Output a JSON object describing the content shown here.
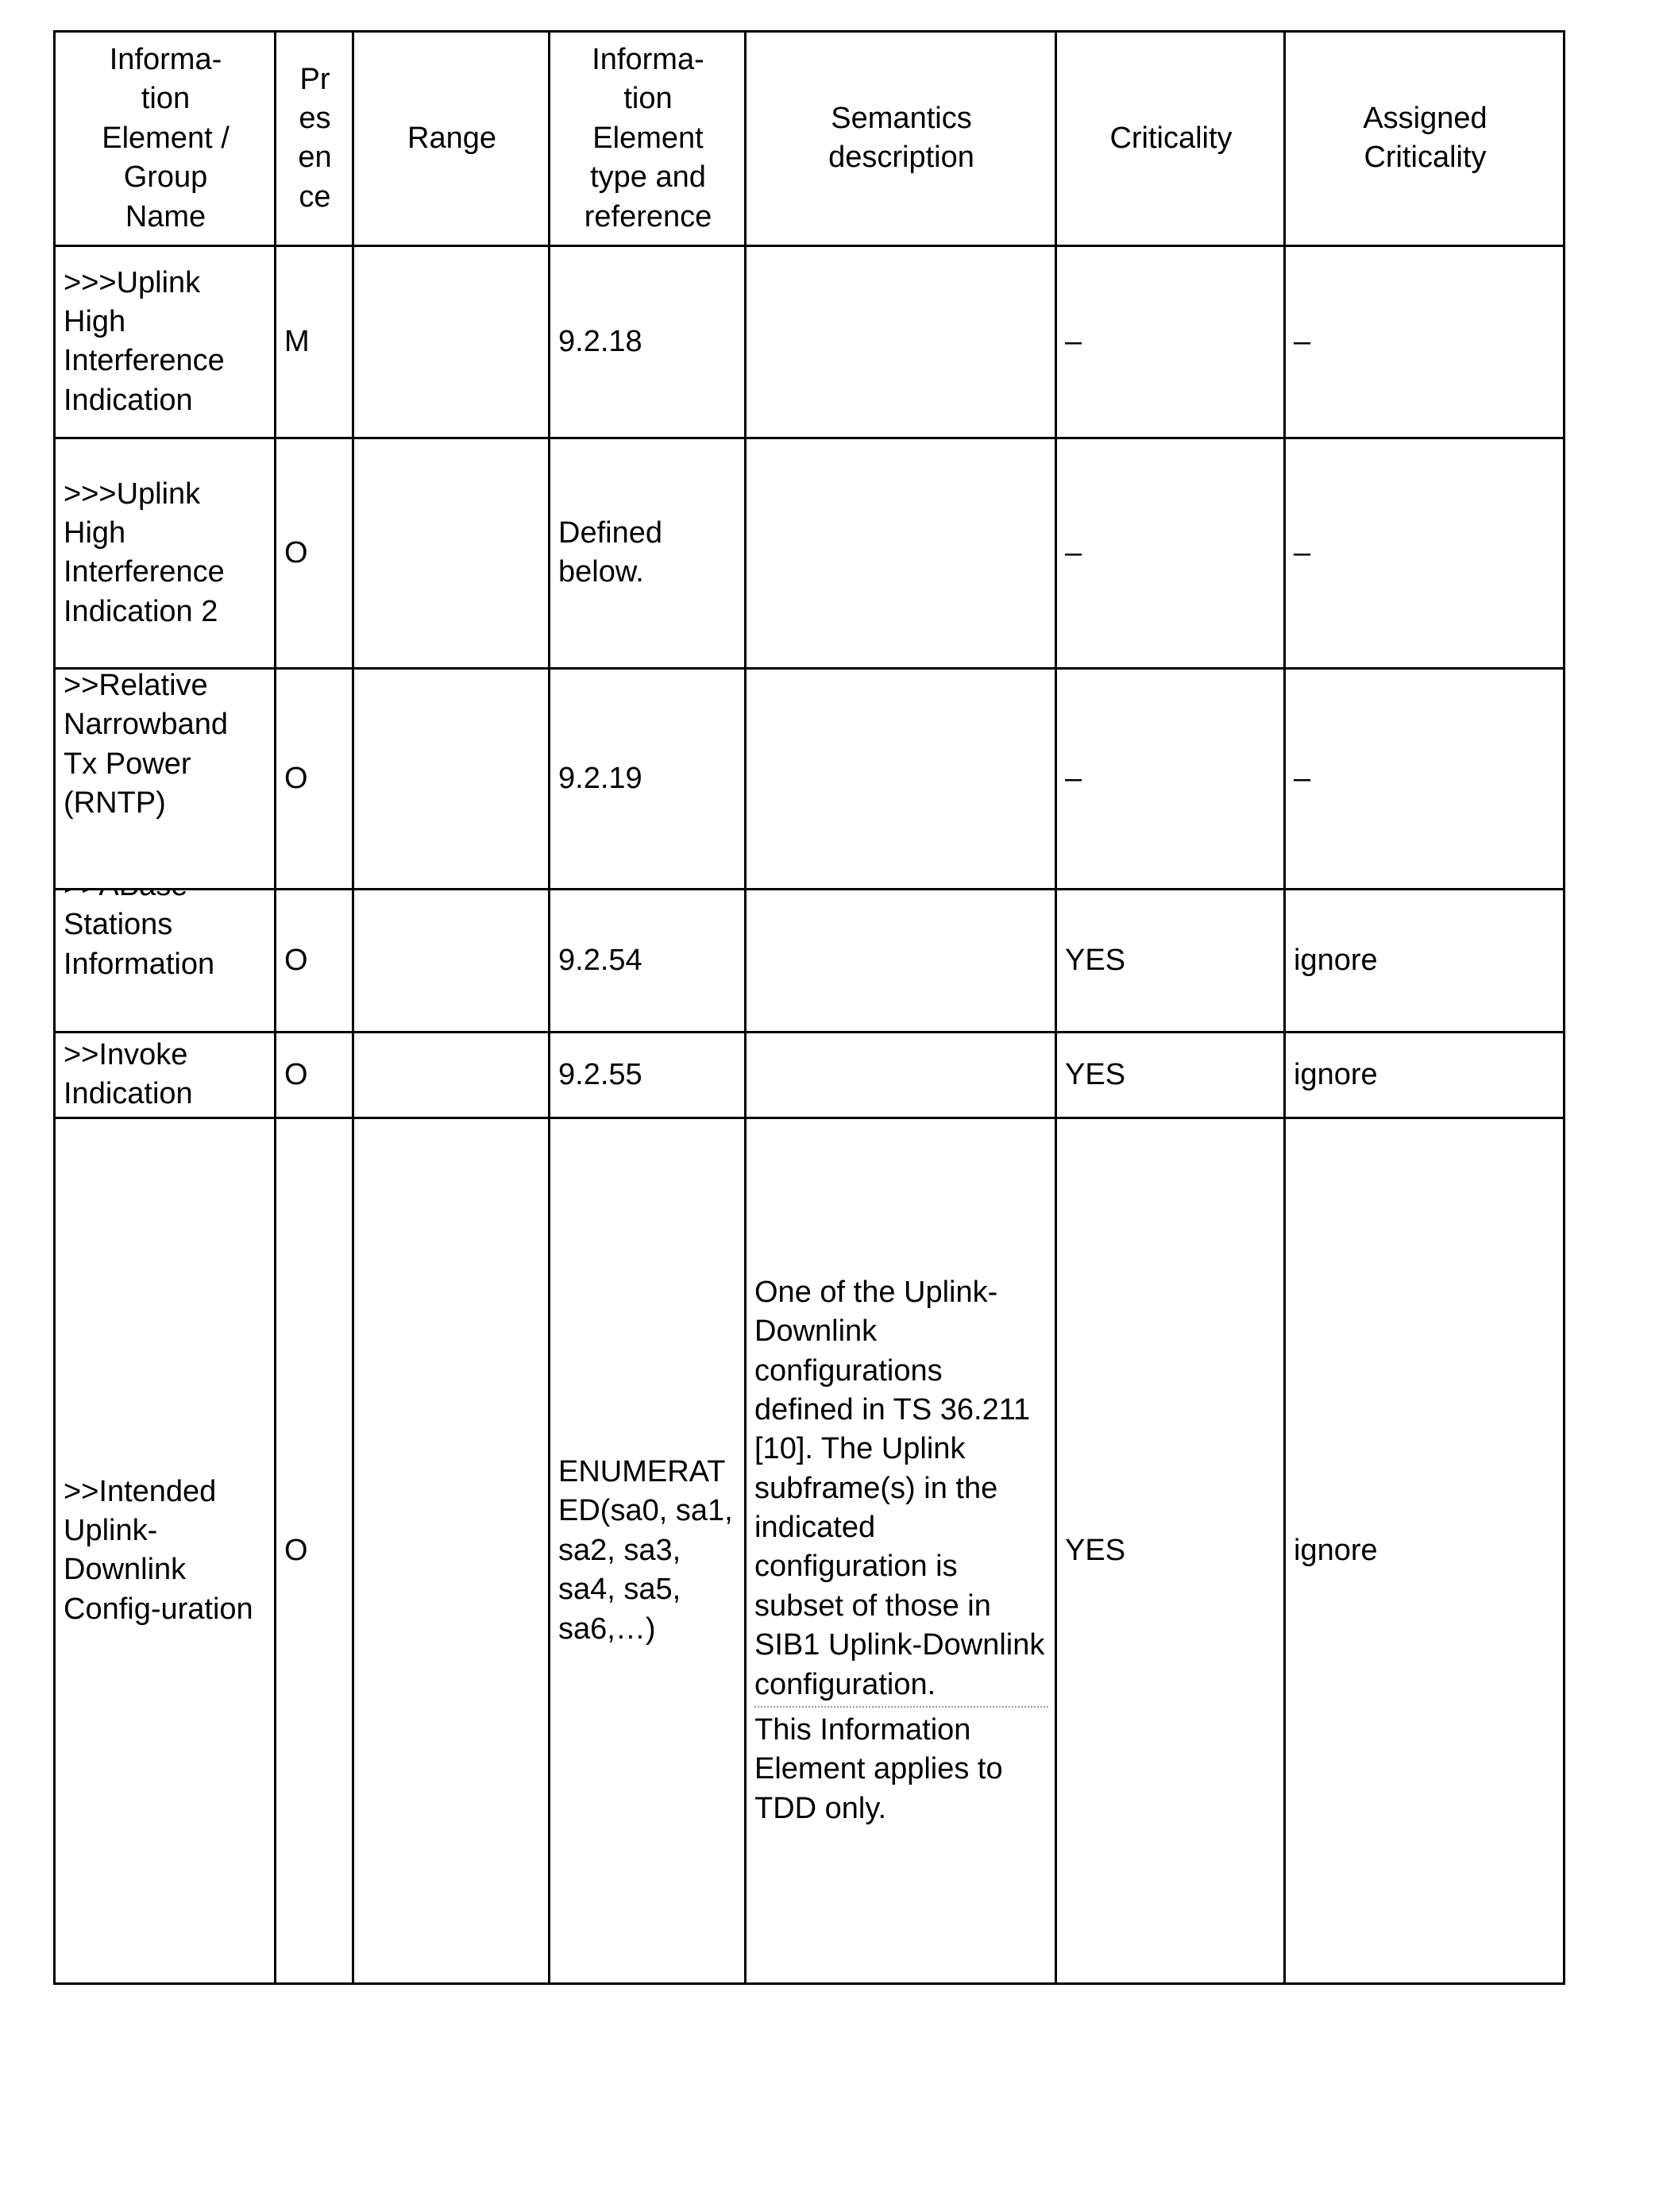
{
  "table": {
    "columns": [
      {
        "key": "ie_name",
        "label": "Informa-\ntion\nElement /\nGroup\nName"
      },
      {
        "key": "presence",
        "label": "Pr\nes\nen\nce"
      },
      {
        "key": "range",
        "label": "Range"
      },
      {
        "key": "ie_type",
        "label": "Informa-\ntion\nElement\ntype and\nreference"
      },
      {
        "key": "semantics",
        "label": "Semantics\ndescription"
      },
      {
        "key": "criticality",
        "label": "Criticality"
      },
      {
        "key": "assigned",
        "label": "Assigned\nCriticality"
      }
    ],
    "column_labels": {
      "ie_name": "Information Element / Group Name",
      "presence": "Presence",
      "range": "Range",
      "ie_type": "Information Element type and reference",
      "semantics": "Semantics description",
      "criticality": "Criticality",
      "assigned": "Assigned Criticality"
    },
    "rows": [
      {
        "id": "uplink-high-interference-indication",
        "ie_name": ">>>Uplink High Interference Indication",
        "presence": "M",
        "range": "",
        "ie_type": "9.2.18",
        "semantics": "",
        "criticality": "–",
        "assigned": "–"
      },
      {
        "id": "uplink-high-interference-indication-2",
        "ie_name": ">>>Uplink High Interference Indication 2",
        "presence": "O",
        "range": "",
        "ie_type": "Defined below.",
        "semantics": "",
        "criticality": "–",
        "assigned": "–"
      },
      {
        "id": "relative-narrowband-tx-power",
        "ie_name": ">>Relative Narrowband Tx Power (RNTP)",
        "presence": "O",
        "range": "",
        "ie_type": "9.2.19",
        "semantics": "",
        "criticality": "–",
        "assigned": "–"
      },
      {
        "id": "abase-stations-information",
        "ie_name": ">>ABase Stations Information",
        "presence": "O",
        "range": "",
        "ie_type": "9.2.54",
        "semantics": "",
        "criticality": "YES",
        "assigned": "ignore"
      },
      {
        "id": "invoke-indication",
        "ie_name": ">>Invoke Indication",
        "presence": "O",
        "range": "",
        "ie_type": "9.2.55",
        "semantics": "",
        "criticality": "YES",
        "assigned": "ignore"
      },
      {
        "id": "intended-uplink-downlink-configuration",
        "ie_name": ">>Intended Uplink-Downlink Config-uration",
        "presence": "O",
        "range": "",
        "ie_type": "ENUMERATED(sa0, sa1, sa2, sa3, sa4, sa5, sa6,…)",
        "semantics_p1": "One of the Uplink-Downlink configurations defined in TS 36.211 [10]. The Uplink subframe(s) in the indicated configuration is subset of those in SIB1 Uplink-Downlink configuration.",
        "semantics_p2": "This Information Element applies to TDD only.",
        "criticality": "YES",
        "assigned": "ignore"
      }
    ]
  },
  "colors": {
    "border": "#000000",
    "text": "#000000",
    "background": "#ffffff",
    "dotted_rule": "#9a9a9a"
  }
}
